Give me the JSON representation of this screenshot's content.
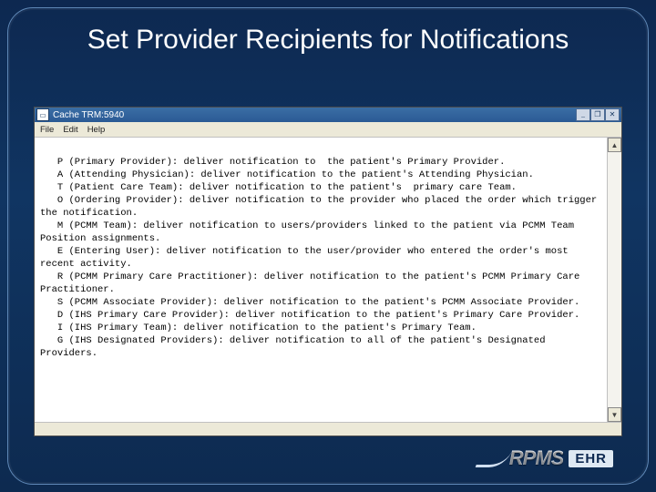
{
  "slide": {
    "title": "Set Provider Recipients for Notifications"
  },
  "window": {
    "title": "Cache TRM:5940",
    "menu": {
      "file": "File",
      "edit": "Edit",
      "help": "Help"
    },
    "controls": {
      "min": "_",
      "max": "❐",
      "close": "✕"
    },
    "scroll": {
      "up": "▲",
      "down": "▼"
    }
  },
  "def": [
    {
      "code": "P",
      "name": "Primary Provider",
      "desc": "deliver notification to  the patient's Primary Provider."
    },
    {
      "code": "A",
      "name": "Attending Physician",
      "desc": "deliver notification to the patient's Attending Physician."
    },
    {
      "code": "T",
      "name": "Patient Care Team",
      "desc": "deliver notification to the patient's  primary care Team."
    },
    {
      "code": "O",
      "name": "Ordering Provider",
      "desc": "deliver notification to the provider who placed the order which trigger the notification."
    },
    {
      "code": "M",
      "name": "PCMM Team",
      "desc": "deliver notification to users/providers linked to the patient via PCMM Team Position assignments."
    },
    {
      "code": "E",
      "name": "Entering User",
      "desc": "deliver notification to the user/provider who entered the order's most recent activity."
    },
    {
      "code": "R",
      "name": "PCMM Primary Care Practitioner",
      "desc": "deliver notification to the patient's PCMM Primary Care Practitioner."
    },
    {
      "code": "S",
      "name": "PCMM Associate Provider",
      "desc": "deliver notification to the patient's PCMM Associate Provider."
    },
    {
      "code": "D",
      "name": "IHS Primary Care Provider",
      "desc": "deliver notification to the patient's Primary Care Provider."
    },
    {
      "code": "I",
      "name": "IHS Primary Team",
      "desc": "deliver notification to the patient's Primary Team."
    },
    {
      "code": "G",
      "name": "IHS Designated Providers",
      "desc": "deliver notification to all of the patient's Designated Providers."
    }
  ],
  "logo": {
    "brand": "RPMS",
    "tag": "EHR"
  }
}
